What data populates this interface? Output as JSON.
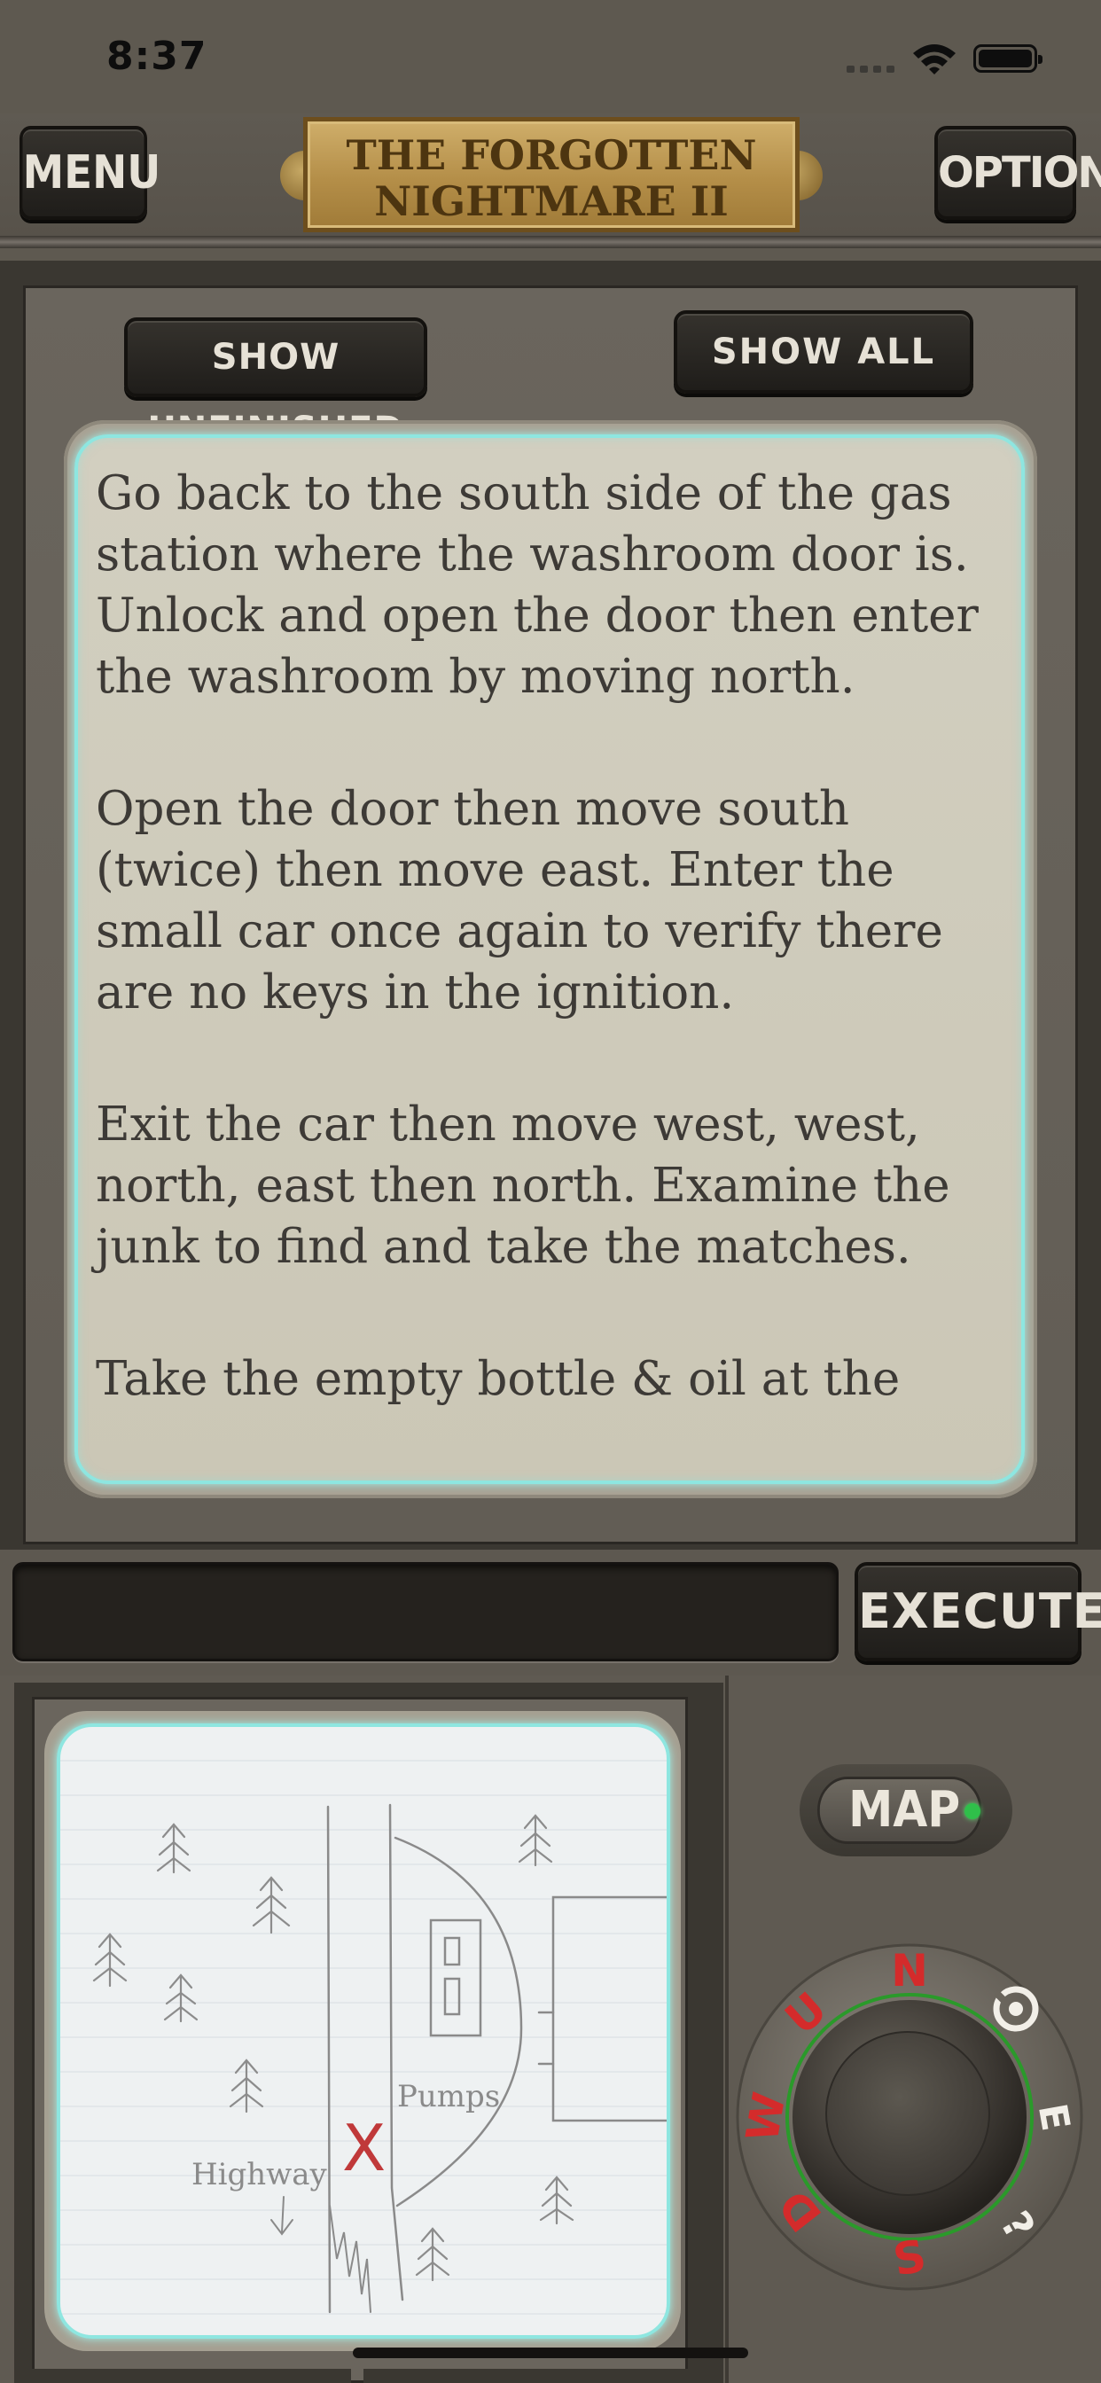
{
  "status_bar": {
    "time": "8:37"
  },
  "header": {
    "menu_label": "MENU",
    "title_line1": "THE FORGOTTEN",
    "title_line2": "NIGHTMARE II",
    "options_label": "OPTIONS"
  },
  "clues": {
    "show_unfinished_label": "SHOW UNFINISHED",
    "show_all_label": "SHOW ALL",
    "paragraphs": [
      "Go back to the south side of the gas station where the washroom door is. Unlock and open the door then enter the washroom by moving north.",
      "Open the door then move south (twice) then move east. Enter the small car once again to verify there are no keys in the ignition.",
      "Exit the car then move west, west, north, east then north. Examine the junk to find and take the matches.",
      "Take the empty bottle & oil at the"
    ]
  },
  "command": {
    "input_value": "",
    "execute_label": "EXECUTE"
  },
  "map": {
    "toggle_label": "MAP",
    "toggle_on": true,
    "status_color": "#2fbf4a",
    "sketch_labels": {
      "pumps": "Pumps",
      "highway": "Highway",
      "marker": "X"
    }
  },
  "compass": {
    "n": "N",
    "s": "S",
    "e": "E",
    "w": "W",
    "u": "U",
    "d": "D",
    "accent_color": "#d42b2b",
    "ring_color": "#2a9a2a"
  },
  "colors": {
    "panel": "#625d55",
    "button_text": "#e6e1d6",
    "glow": "#8ee6e0",
    "plate": "#b48e48"
  }
}
